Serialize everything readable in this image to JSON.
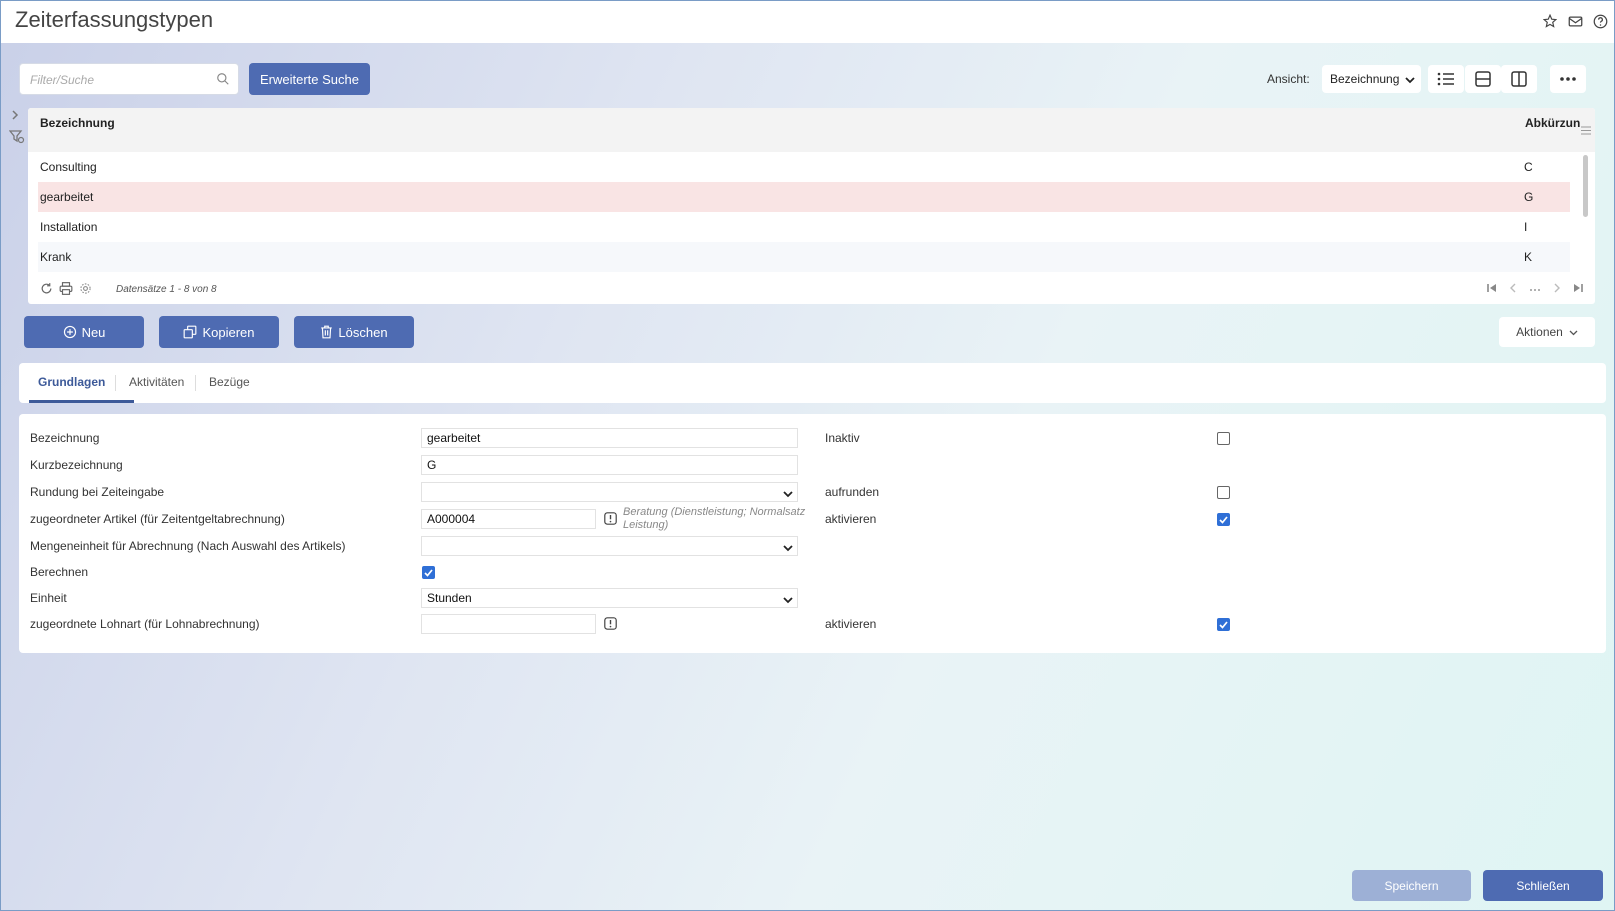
{
  "header": {
    "title": "Zeiterfassungstypen",
    "icons": [
      "star-icon",
      "mail-icon",
      "help-icon"
    ]
  },
  "toolbar": {
    "search_placeholder": "Filter/Suche",
    "advanced_search_label": "Erweiterte Suche",
    "view_label": "Ansicht:",
    "view_value": "Bezeichnung"
  },
  "grid": {
    "columns": [
      "Bezeichnung",
      "Abkürzun"
    ],
    "rows": [
      {
        "bezeichnung": "Consulting",
        "abk": "C",
        "selected": false
      },
      {
        "bezeichnung": "gearbeitet",
        "abk": "G",
        "selected": true
      },
      {
        "bezeichnung": "Installation",
        "abk": "I",
        "selected": false
      },
      {
        "bezeichnung": "Krank",
        "abk": "K",
        "selected": false
      }
    ],
    "records_text": "Datensätze 1 - 8 von 8"
  },
  "actions": {
    "new_label": "Neu",
    "copy_label": "Kopieren",
    "delete_label": "Löschen",
    "more_label": "Aktionen"
  },
  "tabs": [
    {
      "label": "Grundlagen",
      "active": true
    },
    {
      "label": "Aktivitäten",
      "active": false
    },
    {
      "label": "Bezüge",
      "active": false
    }
  ],
  "form": {
    "bezeichnung_label": "Bezeichnung",
    "bezeichnung_value": "gearbeitet",
    "kurz_label": "Kurzbezeichnung",
    "kurz_value": "G",
    "rundung_label": "Rundung bei Zeiteingabe",
    "rundung_value": "",
    "artikel_label": "zugeordneter Artikel (für Zeitentgeltabrechnung)",
    "artikel_value": "A000004",
    "artikel_hint": "Beratung (Dienstleistung; Normalsatz Leistung)",
    "menge_label": "Mengeneinheit für Abrechnung (Nach Auswahl des Artikels)",
    "menge_value": "",
    "berechnen_label": "Berechnen",
    "berechnen_checked": true,
    "einheit_label": "Einheit",
    "einheit_value": "Stunden",
    "lohnart_label": "zugeordnete Lohnart (für Lohnabrechnung)",
    "lohnart_value": "",
    "inaktiv_label": "Inaktiv",
    "inaktiv_checked": false,
    "aufrunden_label": "aufrunden",
    "aufrunden_checked": false,
    "aktivieren1_label": "aktivieren",
    "aktivieren1_checked": true,
    "aktivieren2_label": "aktivieren",
    "aktivieren2_checked": true
  },
  "footer": {
    "save_label": "Speichern",
    "close_label": "Schließen"
  },
  "colors": {
    "primary": "#4e6bb2",
    "selected_row": "#f9e4e4",
    "checkbox": "#2f6fd6"
  }
}
